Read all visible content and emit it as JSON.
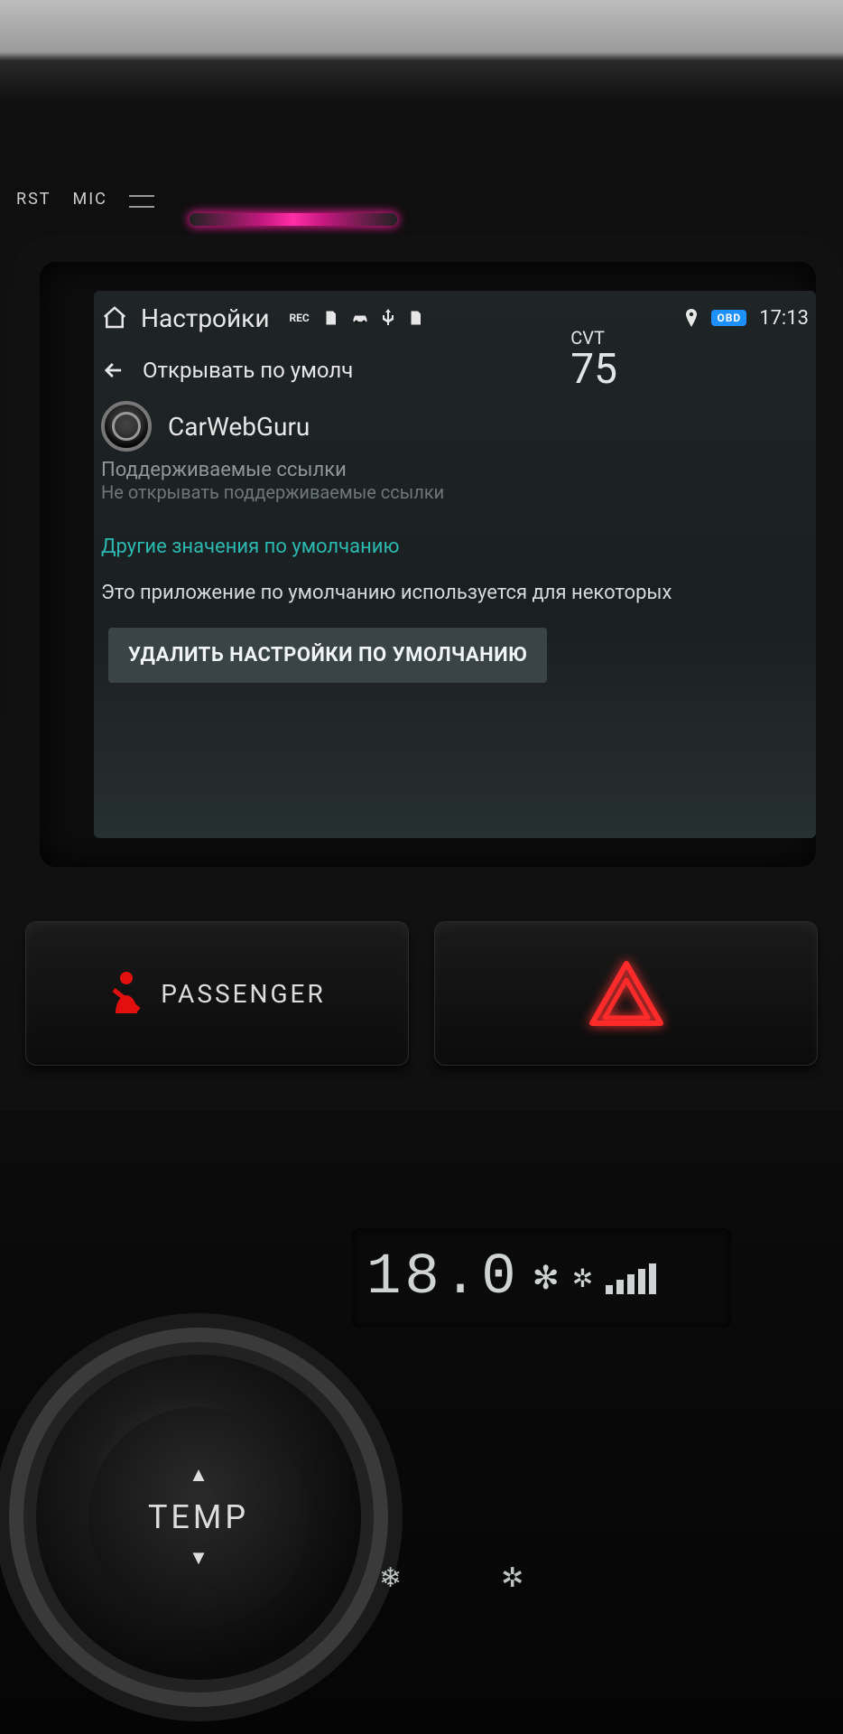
{
  "bezel": {
    "rst": "RST",
    "mic": "MIC"
  },
  "statusbar": {
    "title": "Настройки",
    "rec_label": "REC",
    "obd_label": "OBD",
    "clock": "17:13"
  },
  "subbar": {
    "title": "Открывать по умолч"
  },
  "overlay": {
    "cvt_label": "CVT",
    "cvt_value": "75"
  },
  "app": {
    "name": "CarWebGuru",
    "supported_links_title": "Поддерживаемые ссылки",
    "supported_links_sub": "Не открывать поддерживаемые ссылки"
  },
  "section": {
    "header": "Другие значения по умолчанию",
    "body": "Это приложение по умолчанию используется для некоторых ",
    "button": "УДАЛИТЬ НАСТРОЙКИ ПО УМОЛЧАНИЮ"
  },
  "dash": {
    "passenger": "PASSENGER"
  },
  "climate": {
    "temp": "18.0",
    "knob_label": "TEMP"
  }
}
